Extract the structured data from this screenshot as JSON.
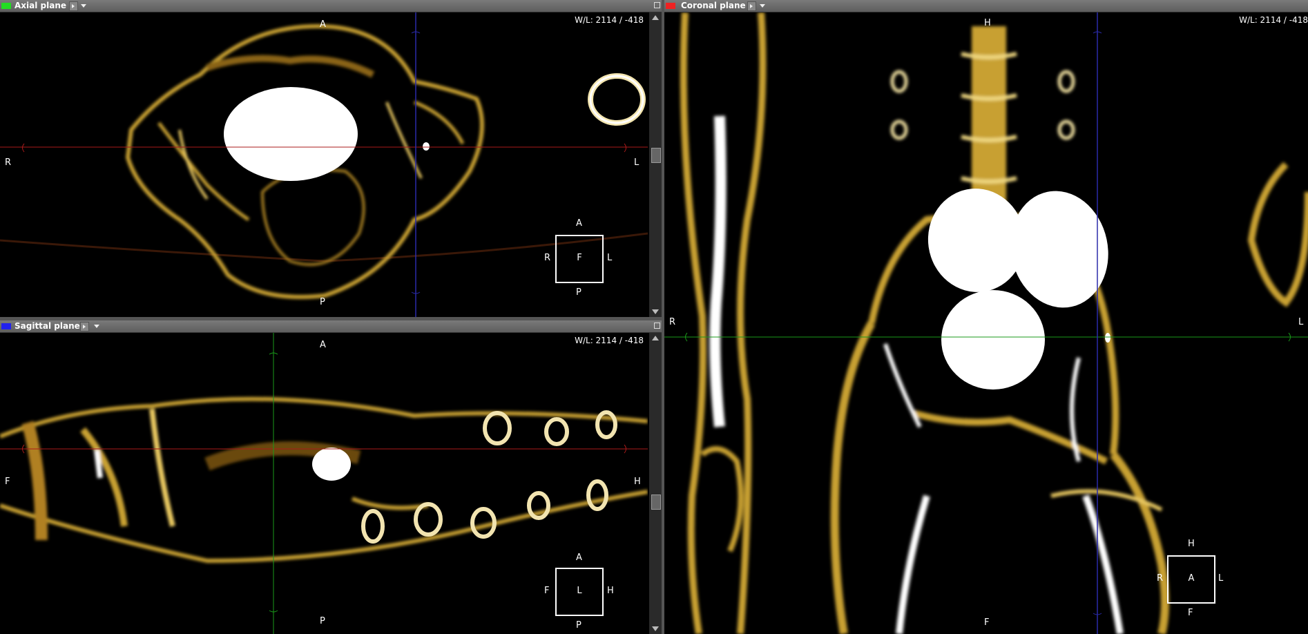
{
  "panes": {
    "axial": {
      "title": "Axial plane",
      "swatch_color": "#22dd22",
      "wl": "W/L: 2114 / -418",
      "labels": {
        "top": "A",
        "bottom": "P",
        "left": "R",
        "right": "L"
      },
      "cube": {
        "center": "F",
        "top": "A",
        "bottom": "P",
        "left": "R",
        "right": "L"
      }
    },
    "sagittal": {
      "title": "Sagittal plane",
      "swatch_color": "#2222ee",
      "wl": "W/L: 2114 / -418",
      "labels": {
        "top": "A",
        "bottom": "P",
        "left": "F",
        "right": "H"
      },
      "cube": {
        "center": "L",
        "top": "A",
        "bottom": "P",
        "left": "F",
        "right": "H"
      }
    },
    "coronal": {
      "title": "Coronal plane",
      "swatch_color": "#ee2222",
      "wl": "W/L: 2114 / -418",
      "labels": {
        "top": "H",
        "bottom": "F",
        "left": "R",
        "right": "L"
      },
      "cube": {
        "center": "A",
        "top": "H",
        "bottom": "F",
        "left": "R",
        "right": "L"
      }
    }
  },
  "colors": {
    "bone": "#c8a030",
    "bone_light": "#f0dc90",
    "bright": "#ffffff",
    "crosshair_red": "#aa1a1a",
    "crosshair_green": "#1a9a1a",
    "crosshair_blue": "#2a2aaa"
  }
}
